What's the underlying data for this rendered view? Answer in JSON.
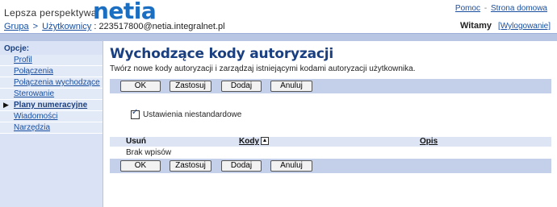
{
  "header": {
    "tagline": "Lepsza perspektywa",
    "logo": "netia",
    "help": "Pomoc",
    "separator": "-",
    "home": "Strona domowa"
  },
  "breadcrumb": {
    "group": "Grupa",
    "arrow": ">",
    "users": "Użytkownicy",
    "user": ": 223517800@netia.integralnet.pl"
  },
  "user": {
    "welcome": "Witamy",
    "logout": "[Wylogowanie]"
  },
  "sidebar": {
    "title": "Opcje:",
    "items": [
      {
        "label": "Profil"
      },
      {
        "label": "Połączenia przychodzące"
      },
      {
        "label": "Połączenia wychodzące"
      },
      {
        "label": "Sterowanie połączeniami"
      },
      {
        "label": "Plany numeracyjne"
      },
      {
        "label": "Wiadomości"
      },
      {
        "label": "Narzędzia"
      }
    ]
  },
  "main": {
    "title": "Wychodzące kody autoryzacji",
    "description": "Twórz nowe kody autoryzacji i zarządzaj istniejącymi kodami autoryzacji użytkownika.",
    "buttons": {
      "ok": "OK",
      "apply": "Zastosuj",
      "add": "Dodaj",
      "cancel": "Anuluj"
    },
    "checkbox": {
      "label": "Ustawienia niestandardowe",
      "checked": true
    },
    "table": {
      "columns": [
        "Usuń",
        "Kody",
        "Opis"
      ],
      "empty": "Brak wpisów"
    }
  },
  "colors": {
    "accent": "#1b6fc2",
    "bar": "#b8c6e4",
    "sidebar": "#d9e3f5",
    "title": "#1a3f80"
  }
}
